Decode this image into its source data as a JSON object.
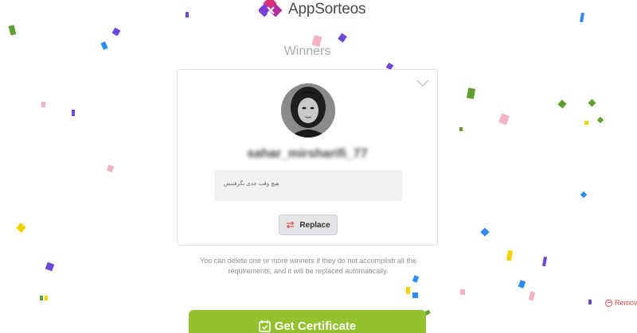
{
  "brand": {
    "name": "AppSorteos",
    "logo_icon": "appsorteos-logo-icon"
  },
  "title": "Winners",
  "winner": {
    "username": "sahar_mirsharifi_77",
    "comment": "هیچ وقت جدی نگرفتنش",
    "expand_icon": "chevron-down-icon"
  },
  "replace_button": {
    "label": "Replace",
    "icon": "swap-arrows-icon"
  },
  "info_text": "You can delete one or more winners if they do not accomplish all the requirements, and it will be replaced automatically.",
  "certificate_button": {
    "label": "Get Certificate",
    "icon": "calendar-check-icon"
  },
  "remove_link": {
    "label": "Remov",
    "icon": "minus-circle-icon"
  },
  "colors": {
    "accent_green": "#94c12e",
    "remove_red": "#e44a4a",
    "brand_purple": "#7b3fd6",
    "brand_pink": "#d6307a"
  }
}
